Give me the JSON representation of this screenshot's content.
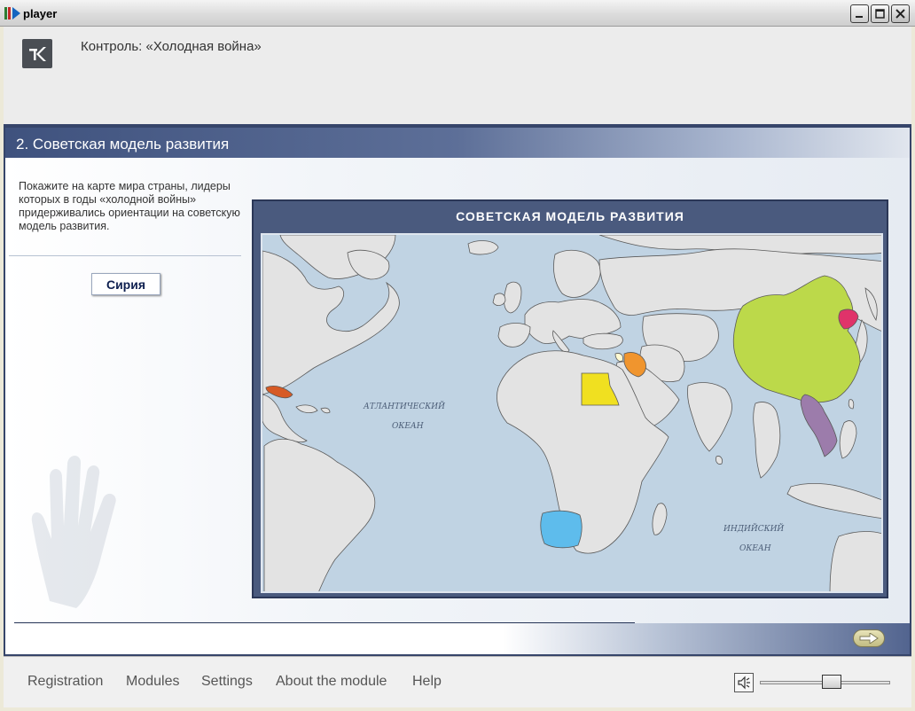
{
  "window": {
    "title": "player"
  },
  "header": {
    "title": "Контроль: «Холодная война»"
  },
  "section": {
    "title": "2. Советская модель развития"
  },
  "task": {
    "instruction": "Покажите на карте мира страны, лидеры которых в годы «холодной войны» придерживались ориентации на советскую модель развития.",
    "answer_label": "Сирия"
  },
  "map": {
    "title": "СОВЕТСКАЯ МОДЕЛЬ РАЗВИТИЯ",
    "atlantic_line1": "АТЛАНТИЧЕСКИЙ",
    "atlantic_line2": "ОКЕАН",
    "indian_line1": "ИНДИЙСКИЙ",
    "indian_line2": "ОКЕАН",
    "colors": {
      "water": "#c0d3e3",
      "land": "#e3e3e3",
      "china": "#bcd94a",
      "korea": "#e0336a",
      "indochina": "#9c7cab",
      "angola": "#5ebcec",
      "egypt": "#f0e020",
      "iraq": "#f0952e",
      "cuba": "#d65a25",
      "syria": "#fffad2"
    }
  },
  "footer": {
    "menu": [
      {
        "label": "Registration"
      },
      {
        "label": "Modules"
      },
      {
        "label": "Settings"
      },
      {
        "label": "About the module"
      },
      {
        "label": "Help"
      }
    ],
    "volume": 0.55
  }
}
